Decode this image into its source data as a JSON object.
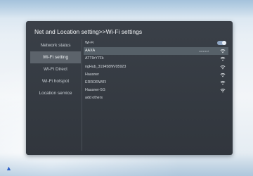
{
  "panel": {
    "title": "Net and Location setting>>Wi-Fi settings"
  },
  "sidebar": {
    "items": [
      {
        "label": "Network status",
        "active": false
      },
      {
        "label": "Wi-Fi setting",
        "active": true
      },
      {
        "label": "Wi-Fi Direct",
        "active": false
      },
      {
        "label": "Wi-Fi hotspot",
        "active": false
      },
      {
        "label": "Location service",
        "active": false
      }
    ]
  },
  "wifi": {
    "toggle_label": "Wi-Fi",
    "toggle_on": true,
    "networks": [
      {
        "name": "AAXA",
        "status": "connect",
        "selected": true,
        "icon": "wifi-icon"
      },
      {
        "name": "ATT9rY7Fk",
        "status": "",
        "selected": false,
        "icon": "wifi-icon"
      },
      {
        "name": "ngHub_319458NV05923",
        "status": "",
        "selected": false,
        "icon": "wifi-icon"
      },
      {
        "name": "Hausner",
        "status": "",
        "selected": false,
        "icon": "wifi-icon"
      },
      {
        "name": "ERRORWIFI",
        "status": "",
        "selected": false,
        "icon": "wifi-icon"
      },
      {
        "name": "Hausner-5G",
        "status": "",
        "selected": false,
        "icon": "wifi-icon"
      }
    ],
    "add_others_label": "add others"
  },
  "colors": {
    "panel_bg": "#363b42",
    "selected_bg": "#566068",
    "sidebar_active_bg": "#5c636b",
    "toggle_accent": "#8fa6c4",
    "corner_arrow": "#2a5ec8"
  },
  "corner_icon": "arrow-up-icon"
}
